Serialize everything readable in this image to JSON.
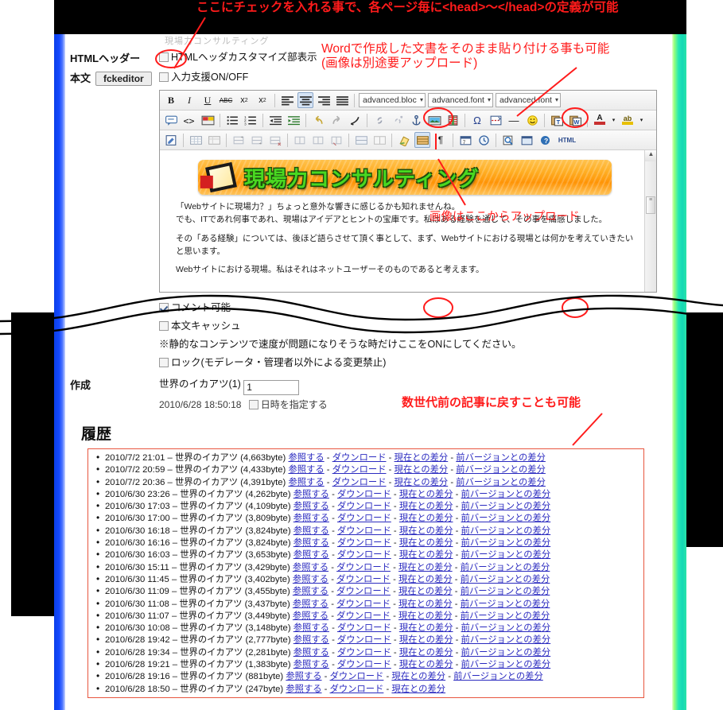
{
  "annotations": {
    "head_def": "ここにチェックを入れる事で、各ページ毎に<head>〜</head>の定義が可能",
    "word_paste": "Wordで作成した文書をそのまま貼り付ける事も可能\n(画像は別途要アップロード)",
    "image_upload": "画像はここからアップロード",
    "history_revert": "数世代前の記事に戻すことも可能"
  },
  "form": {
    "faded_top_text": "現場力コンサルティング",
    "html_header": {
      "label": "HTMLヘッダー",
      "checkbox_label": "HTMLヘッダカスタマイズ部表示",
      "checked": false
    },
    "body": {
      "label": "本文",
      "button": "fckeditor",
      "checkbox_label": "入力支援ON/OFF",
      "checked": false
    },
    "options": [
      {
        "label": "コメント可能",
        "checked": true
      },
      {
        "label": "本文キャッシュ",
        "checked": false
      }
    ],
    "note": "※静的なコンテンツで速度が問題になりそうな時だけここをONにしてください。",
    "lock": {
      "label": "ロック(モデレータ・管理者以外による変更禁止)",
      "checked": false
    },
    "created": {
      "label": "作成",
      "author": "世界のイカアツ(1)",
      "value": "1",
      "datetime": "2010/6/28 18:50:18",
      "datetime_checkbox_label": "日時を指定する",
      "datetime_checked": false
    }
  },
  "editor": {
    "toolbar_row1": [
      {
        "name": "bold",
        "glyph": "B"
      },
      {
        "name": "italic",
        "glyph": "I"
      },
      {
        "name": "underline",
        "glyph": "U"
      },
      {
        "name": "strikethrough",
        "glyph": "ABC"
      },
      {
        "name": "subscript",
        "glyph": "x₂"
      },
      {
        "name": "superscript",
        "glyph": "x²"
      },
      {
        "name": "align-left",
        "glyph": "≡"
      },
      {
        "name": "align-center",
        "glyph": "≡"
      },
      {
        "name": "align-right",
        "glyph": "≡"
      },
      {
        "name": "align-justify",
        "glyph": "≡"
      }
    ],
    "selects": [
      "advanced.bloc",
      "advanced.font",
      "advanced.font"
    ],
    "toolbar_row2_names": [
      "comment",
      "source",
      "templates",
      "bulleted-list",
      "numbered-list",
      "outdent",
      "indent",
      "undo",
      "redo",
      "remove-format",
      "link",
      "unlink",
      "anchor",
      "image",
      "flash",
      "special-char",
      "page-break",
      "horizontal-rule",
      "smiley",
      "paste-text",
      "paste-word",
      "text-color",
      "background-color"
    ],
    "toolbar_row3_names": [
      "new-page",
      "table",
      "table-props",
      "insert-row-before",
      "insert-row-after",
      "delete-row",
      "insert-col-before",
      "insert-col-after",
      "delete-col",
      "merge-cells",
      "split-cell",
      "eraser",
      "show-blocks",
      "show-marks",
      "calendar",
      "clock",
      "preview",
      "maximize",
      "about",
      "HTML"
    ],
    "content": {
      "banner_text": "現場力コンサルティング",
      "paragraphs": [
        "「Webサイトに現場力？」ちょっと意外な響きに感じるかも知れませんね。",
        "でも、ITであれ何事であれ、現場はアイデアとヒントの宝庫です。私はある経験を通じて、その事を痛感しました。",
        "その「ある経験」については、後ほど語らさせて頂く事として、まず、Webサイトにおける現場とは何かを考えていきたいと思います。",
        "Webサイトにおける現場。私はそれはネットユーザーそのものであると考えます。"
      ]
    }
  },
  "history": {
    "title": "履歴",
    "link_labels": {
      "view": "参照する",
      "download": "ダウンロード",
      "diff_current": "現在との差分",
      "diff_prev": "前バージョンとの差分"
    },
    "entries": [
      {
        "datetime": "2010/7/2 21:01",
        "author": "世界のイカアツ",
        "size": "(4,663byte)",
        "has_prev": true
      },
      {
        "datetime": "2010/7/2 20:59",
        "author": "世界のイカアツ",
        "size": "(4,433byte)",
        "has_prev": true
      },
      {
        "datetime": "2010/7/2 20:36",
        "author": "世界のイカアツ",
        "size": "(4,391byte)",
        "has_prev": true
      },
      {
        "datetime": "2010/6/30 23:26",
        "author": "世界のイカアツ",
        "size": "(4,262byte)",
        "has_prev": true
      },
      {
        "datetime": "2010/6/30 17:03",
        "author": "世界のイカアツ",
        "size": "(4,109byte)",
        "has_prev": true
      },
      {
        "datetime": "2010/6/30 17:00",
        "author": "世界のイカアツ",
        "size": "(3,809byte)",
        "has_prev": true
      },
      {
        "datetime": "2010/6/30 16:18",
        "author": "世界のイカアツ",
        "size": "(3,824byte)",
        "has_prev": true
      },
      {
        "datetime": "2010/6/30 16:16",
        "author": "世界のイカアツ",
        "size": "(3,824byte)",
        "has_prev": true
      },
      {
        "datetime": "2010/6/30 16:03",
        "author": "世界のイカアツ",
        "size": "(3,653byte)",
        "has_prev": true
      },
      {
        "datetime": "2010/6/30 15:11",
        "author": "世界のイカアツ",
        "size": "(3,429byte)",
        "has_prev": true
      },
      {
        "datetime": "2010/6/30 11:45",
        "author": "世界のイカアツ",
        "size": "(3,402byte)",
        "has_prev": true
      },
      {
        "datetime": "2010/6/30 11:09",
        "author": "世界のイカアツ",
        "size": "(3,455byte)",
        "has_prev": true
      },
      {
        "datetime": "2010/6/30 11:08",
        "author": "世界のイカアツ",
        "size": "(3,437byte)",
        "has_prev": true
      },
      {
        "datetime": "2010/6/30 11:07",
        "author": "世界のイカアツ",
        "size": "(3,449byte)",
        "has_prev": true
      },
      {
        "datetime": "2010/6/30 10:08",
        "author": "世界のイカアツ",
        "size": "(3,148byte)",
        "has_prev": true
      },
      {
        "datetime": "2010/6/28 19:42",
        "author": "世界のイカアツ",
        "size": "(2,777byte)",
        "has_prev": true
      },
      {
        "datetime": "2010/6/28 19:34",
        "author": "世界のイカアツ",
        "size": "(2,281byte)",
        "has_prev": true
      },
      {
        "datetime": "2010/6/28 19:21",
        "author": "世界のイカアツ",
        "size": "(1,383byte)",
        "has_prev": true
      },
      {
        "datetime": "2010/6/28 19:16",
        "author": "世界のイカアツ",
        "size": "(881byte)",
        "has_prev": true
      },
      {
        "datetime": "2010/6/28 18:50",
        "author": "世界のイカアツ",
        "size": "(247byte)",
        "has_prev": false
      }
    ]
  },
  "colors": {
    "annotation_red": "#ff1b1b",
    "left_edge_blue": "#1348ff",
    "right_edge_green": "#23e8b4",
    "history_border": "#e8563f",
    "link_blue": "#2b2bc0"
  }
}
